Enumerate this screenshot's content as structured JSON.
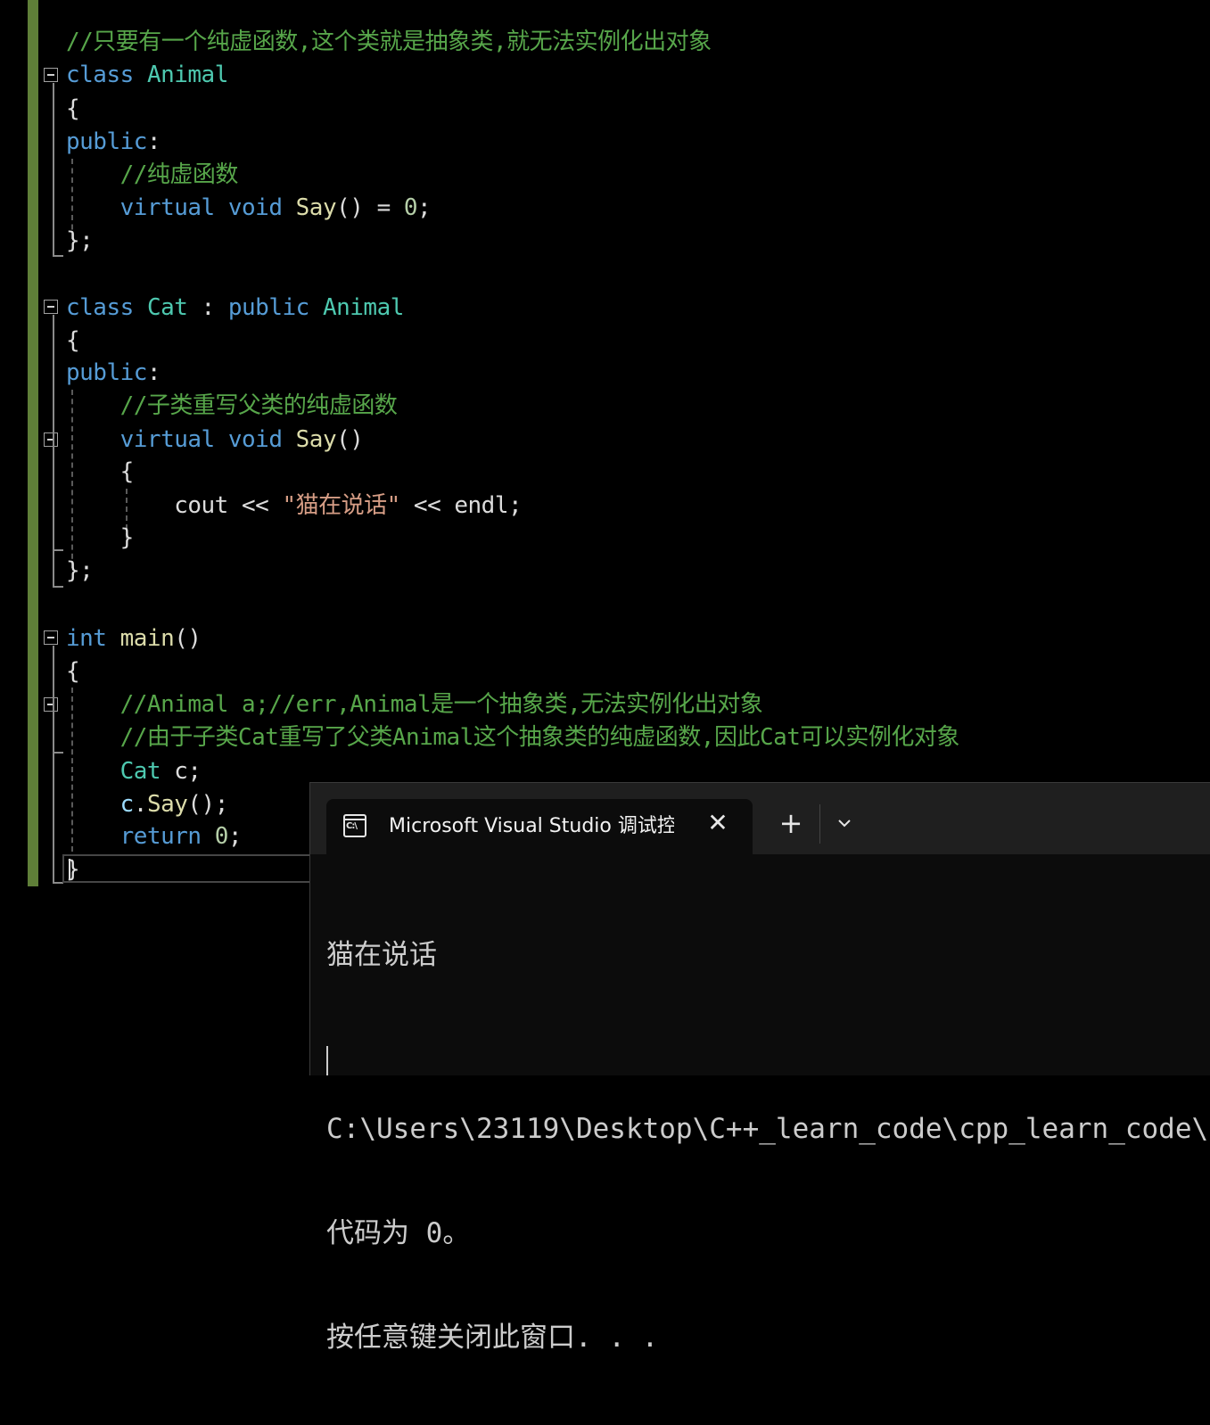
{
  "editor": {
    "lines": [
      {
        "id": "l1",
        "tokens": [
          {
            "t": "//只要有一个纯虚函数,这个类就是抽象类,就无法实例化出对象",
            "c": "cm"
          }
        ]
      },
      {
        "id": "l2",
        "tokens": [
          {
            "t": "class",
            "c": "kw"
          },
          {
            "t": " ",
            "c": "pl"
          },
          {
            "t": "Animal",
            "c": "ty"
          }
        ]
      },
      {
        "id": "l3",
        "tokens": [
          {
            "t": "{",
            "c": "pl"
          }
        ]
      },
      {
        "id": "l4",
        "tokens": [
          {
            "t": "public",
            "c": "kw"
          },
          {
            "t": ":",
            "c": "pl"
          }
        ]
      },
      {
        "id": "l5",
        "tokens": [
          {
            "t": "    ",
            "c": "pl"
          },
          {
            "t": "//纯虚函数",
            "c": "cm"
          }
        ]
      },
      {
        "id": "l6",
        "tokens": [
          {
            "t": "    ",
            "c": "pl"
          },
          {
            "t": "virtual",
            "c": "kw"
          },
          {
            "t": " ",
            "c": "pl"
          },
          {
            "t": "void",
            "c": "kw"
          },
          {
            "t": " ",
            "c": "pl"
          },
          {
            "t": "Say",
            "c": "fn"
          },
          {
            "t": "() = ",
            "c": "pl"
          },
          {
            "t": "0",
            "c": "nm"
          },
          {
            "t": ";",
            "c": "pl"
          }
        ]
      },
      {
        "id": "l7",
        "tokens": [
          {
            "t": "};",
            "c": "pl"
          }
        ]
      },
      {
        "id": "l8",
        "tokens": []
      },
      {
        "id": "l9",
        "tokens": [
          {
            "t": "class",
            "c": "kw"
          },
          {
            "t": " ",
            "c": "pl"
          },
          {
            "t": "Cat",
            "c": "ty"
          },
          {
            "t": " : ",
            "c": "pl"
          },
          {
            "t": "public",
            "c": "kw"
          },
          {
            "t": " ",
            "c": "pl"
          },
          {
            "t": "Animal",
            "c": "ty"
          }
        ]
      },
      {
        "id": "l10",
        "tokens": [
          {
            "t": "{",
            "c": "pl"
          }
        ]
      },
      {
        "id": "l11",
        "tokens": [
          {
            "t": "public",
            "c": "kw"
          },
          {
            "t": ":",
            "c": "pl"
          }
        ]
      },
      {
        "id": "l12",
        "tokens": [
          {
            "t": "    ",
            "c": "pl"
          },
          {
            "t": "//子类重写父类的纯虚函数",
            "c": "cm"
          }
        ]
      },
      {
        "id": "l13",
        "tokens": [
          {
            "t": "    ",
            "c": "pl"
          },
          {
            "t": "virtual",
            "c": "kw"
          },
          {
            "t": " ",
            "c": "pl"
          },
          {
            "t": "void",
            "c": "kw"
          },
          {
            "t": " ",
            "c": "pl"
          },
          {
            "t": "Say",
            "c": "fn"
          },
          {
            "t": "()",
            "c": "pl"
          }
        ]
      },
      {
        "id": "l14",
        "tokens": [
          {
            "t": "    {",
            "c": "pl"
          }
        ]
      },
      {
        "id": "l15",
        "tokens": [
          {
            "t": "        cout << ",
            "c": "pl"
          },
          {
            "t": "\"猫在说话\"",
            "c": "st"
          },
          {
            "t": " << endl;",
            "c": "pl"
          }
        ]
      },
      {
        "id": "l16",
        "tokens": [
          {
            "t": "    }",
            "c": "pl"
          }
        ]
      },
      {
        "id": "l17",
        "tokens": [
          {
            "t": "};",
            "c": "pl"
          }
        ]
      },
      {
        "id": "l18",
        "tokens": []
      },
      {
        "id": "l19",
        "tokens": [
          {
            "t": "int",
            "c": "kw"
          },
          {
            "t": " ",
            "c": "pl"
          },
          {
            "t": "main",
            "c": "fn"
          },
          {
            "t": "()",
            "c": "pl"
          }
        ]
      },
      {
        "id": "l20",
        "tokens": [
          {
            "t": "{",
            "c": "pl"
          }
        ]
      },
      {
        "id": "l21",
        "tokens": [
          {
            "t": "    ",
            "c": "pl"
          },
          {
            "t": "//Animal a;//err,Animal是一个抽象类,无法实例化出对象",
            "c": "cm"
          }
        ]
      },
      {
        "id": "l22",
        "tokens": [
          {
            "t": "    ",
            "c": "pl"
          },
          {
            "t": "//由于子类Cat重写了父类Animal这个抽象类的纯虚函数,因此Cat可以实例化对象",
            "c": "cm"
          }
        ]
      },
      {
        "id": "l23",
        "tokens": [
          {
            "t": "    ",
            "c": "pl"
          },
          {
            "t": "Cat",
            "c": "ty"
          },
          {
            "t": " c;",
            "c": "pl"
          }
        ]
      },
      {
        "id": "l24",
        "tokens": [
          {
            "t": "    ",
            "c": "pl"
          },
          {
            "t": "c",
            "c": "vr"
          },
          {
            "t": ".",
            "c": "pl"
          },
          {
            "t": "Say",
            "c": "fn"
          },
          {
            "t": "();",
            "c": "pl"
          }
        ]
      },
      {
        "id": "l25",
        "tokens": [
          {
            "t": "    ",
            "c": "pl"
          },
          {
            "t": "return",
            "c": "kw"
          },
          {
            "t": " ",
            "c": "pl"
          },
          {
            "t": "0",
            "c": "nm"
          },
          {
            "t": ";",
            "c": "pl"
          }
        ]
      },
      {
        "id": "l26",
        "tokens": [
          {
            "t": "}",
            "c": "pl"
          }
        ]
      }
    ]
  },
  "terminal": {
    "tab_title": "Microsoft Visual Studio 调试控制台",
    "tab_icon_text": "C:\\",
    "close_glyph": "✕",
    "new_tab_glyph": "+",
    "output_lines": [
      "猫在说话",
      "",
      "C:\\Users\\23119\\Desktop\\C++_learn_code\\cpp_learn_code\\",
      "代码为 0。",
      "按任意键关闭此窗口. . ."
    ]
  }
}
